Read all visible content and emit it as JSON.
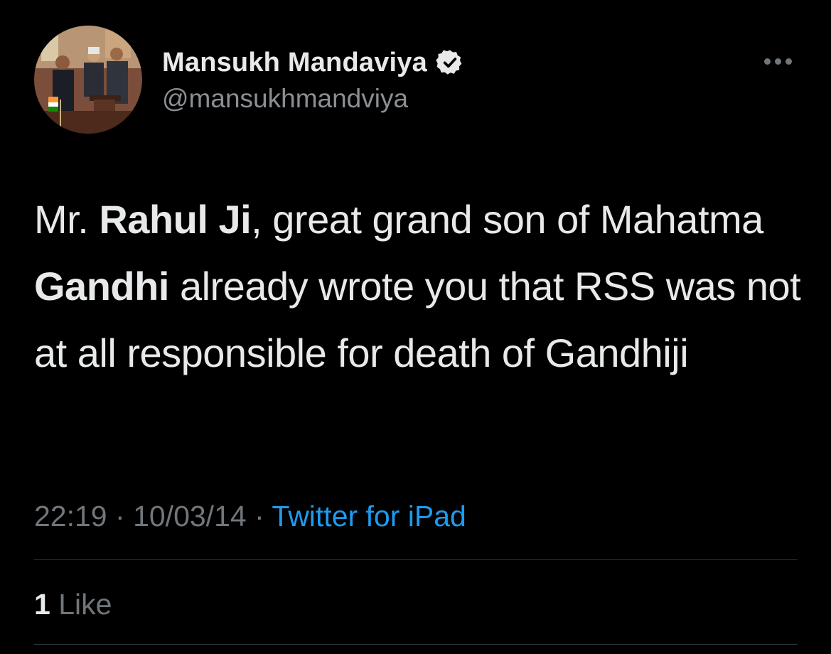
{
  "author": {
    "display_name": "Mansukh Mandaviya",
    "handle": "@mansukhmandviya",
    "verified_icon": "verified-badge-icon",
    "avatar": "profile-photo"
  },
  "menu": {
    "icon": "more-options-icon"
  },
  "tweet": {
    "parts": [
      {
        "text": "Mr. ",
        "bold": false
      },
      {
        "text": "Rahul Ji",
        "bold": true
      },
      {
        "text": ", great grand son of Mahatma ",
        "bold": false
      },
      {
        "text": "Gandhi",
        "bold": true
      },
      {
        "text": " already wrote you that RSS was not at all responsible for death of Gandhiji",
        "bold": false
      }
    ]
  },
  "meta": {
    "time": "22:19",
    "separator": "·",
    "date": "10/03/14",
    "source": "Twitter for iPad"
  },
  "stats": {
    "likes_count": "1",
    "likes_label": "Like"
  },
  "colors": {
    "background": "#000000",
    "primary_text": "#e7e9ea",
    "secondary_text": "#71767b",
    "link": "#1d9bf0",
    "divider": "#2f3336"
  }
}
